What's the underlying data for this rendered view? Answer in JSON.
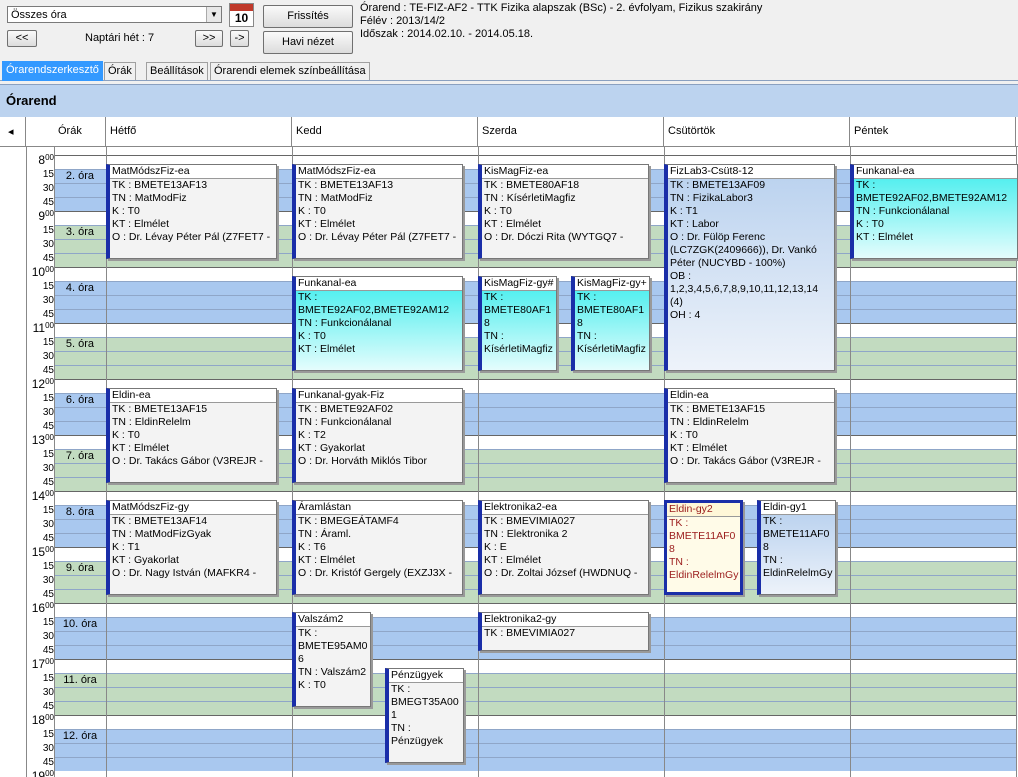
{
  "toolbar": {
    "combo_value": "Összes óra",
    "cal_icon_day": "10",
    "prev_label": "<<",
    "week_label": "Naptári hét : 7",
    "next_label": ">>",
    "next_small_label": "->",
    "refresh_label": "Frissítés",
    "month_view_label": "Havi nézet"
  },
  "info": {
    "line1": "Órarend : TE-FIZ-AF2 - TTK Fizika alapszak (BSc) - 2. évfolyam, Fizikus szakirány",
    "line2": "Félév : 2013/14/2",
    "line3": "Időszak : 2014.02.10. - 2014.05.18."
  },
  "tabs": [
    "Órarendszerkesztő",
    "Órák",
    "Beállítások",
    "Órarendi elemek színbeállítása"
  ],
  "panel_title": "Órarend",
  "grid": {
    "scroll_left": "◂",
    "headers": [
      "Órák",
      "Hétfő",
      "Kedd",
      "Szerda",
      "Csütörtök",
      "Péntek"
    ],
    "hours": [
      "8",
      "9",
      "10",
      "11",
      "12",
      "13",
      "14",
      "15",
      "16",
      "17",
      "18",
      "19"
    ],
    "minute_sup": "00",
    "minutes": [
      "15",
      "30",
      "45"
    ],
    "slots": [
      "2. óra",
      "3. óra",
      "4. óra",
      "5. óra",
      "6. óra",
      "7. óra",
      "8. óra",
      "9. óra",
      "10. óra",
      "11. óra",
      "12. óra"
    ]
  },
  "colors": {
    "blue_band": "#a9c8ef",
    "green_band": "#c2dbc0",
    "card_border": "#1a2ea8",
    "tab_active": "#3399ff"
  },
  "events": [
    {
      "title": "MatMódszFiz-ea",
      "lines": [
        "TK : BMETE13AF13",
        "TN : MatModFiz",
        "K : T0",
        "KT : Elmélet",
        "O : Dr. Lévay Péter Pál (Z7FET7 -"
      ]
    },
    {
      "title": "MatMódszFiz-ea",
      "lines": [
        "TK : BMETE13AF13",
        "TN : MatModFiz",
        "K : T0",
        "KT : Elmélet",
        "O : Dr. Lévay Péter Pál (Z7FET7 -"
      ]
    },
    {
      "title": "KisMagFiz-ea",
      "lines": [
        "TK : BMETE80AF18",
        "TN : KísérletiMagfiz",
        "K : T0",
        "KT : Elmélet",
        "O : Dr. Dóczi Rita (WYTGQ7 -"
      ]
    },
    {
      "title": "FizLab3-Csüt8-12",
      "lines": [
        "TK : BMETE13AF09",
        "TN : FizikaLabor3",
        "K : T1",
        "KT : Labor",
        "O : Dr. Fülöp Ferenc",
        "(LC7ZGK(2409666)), Dr. Vankó",
        "Péter (NUCYBD - 100%)",
        "OB :",
        "1,2,3,4,5,6,7,8,9,10,11,12,13,14",
        "(4)",
        "OH : 4"
      ]
    },
    {
      "title": "Funkanal-ea",
      "lines": [
        "TK :",
        "BMETE92AF02,BMETE92AM12",
        "TN : Funkcionálanal",
        "K : T0",
        "KT : Elmélet"
      ]
    },
    {
      "title": "Funkanal-ea",
      "lines": [
        "TK :",
        "BMETE92AF02,BMETE92AM12",
        "TN : Funkcionálanal",
        "K : T0",
        "KT : Elmélet"
      ]
    },
    {
      "title": "KisMagFiz-gy#",
      "lines": [
        "TK :",
        "BMETE80AF1",
        "8",
        "TN :",
        "KísérletiMagfiz"
      ]
    },
    {
      "title": "KisMagFiz-gy+",
      "lines": [
        "TK :",
        "BMETE80AF1",
        "8",
        "TN :",
        "KísérletiMagfiz"
      ]
    },
    {
      "title": "Eldin-ea",
      "lines": [
        "TK : BMETE13AF15",
        "TN : EldinRelelm",
        "K : T0",
        "KT : Elmélet",
        "O : Dr. Takács Gábor (V3REJR -"
      ]
    },
    {
      "title": "Funkanal-gyak-Fiz",
      "lines": [
        "TK : BMETE92AF02",
        "TN : Funkcionálanal",
        "K : T2",
        "KT : Gyakorlat",
        "O : Dr. Horváth Miklós Tibor"
      ]
    },
    {
      "title": "Eldin-ea",
      "lines": [
        "TK : BMETE13AF15",
        "TN : EldinRelelm",
        "K : T0",
        "KT : Elmélet",
        "O : Dr. Takács Gábor (V3REJR -"
      ]
    },
    {
      "title": "MatMódszFiz-gy",
      "lines": [
        "TK : BMETE13AF14",
        "TN : MatModFizGyak",
        "K : T1",
        "KT : Gyakorlat",
        "O : Dr. Nagy István (MAFKR4 -"
      ]
    },
    {
      "title": "Áramlástan",
      "lines": [
        "TK : BMEGEÁTAMF4",
        "TN : Áraml.",
        "K : T6",
        "KT : Elmélet",
        "O : Dr. Kristóf Gergely (EXZJ3X -"
      ]
    },
    {
      "title": "Elektronika2-ea",
      "lines": [
        "TK : BMEVIMIA027",
        "TN : Elektronika 2",
        "K : E",
        "KT : Elmélet",
        "O : Dr. Zoltai József (HWDNUQ -"
      ]
    },
    {
      "title": "Eldin-gy2",
      "lines": [
        "TK :",
        "BMETE11AF0",
        "8",
        "TN :",
        "EldinRelelmGy"
      ]
    },
    {
      "title": "Eldin-gy1",
      "lines": [
        "TK :",
        "BMETE11AF0",
        "8",
        "TN :",
        "EldinRelelmGy"
      ]
    },
    {
      "title": "Valszám2",
      "lines": [
        "TK :",
        "BMETE95AM0",
        "6",
        "TN : Valszám2",
        "K : T0"
      ]
    },
    {
      "title": "Elektronika2-gy",
      "lines": [
        "TK : BMEVIMIA027"
      ]
    },
    {
      "title": "Pénzügyek",
      "lines": [
        "TK :",
        "BMEGT35A00",
        "1",
        "TN :",
        "Pénzügyek"
      ]
    }
  ]
}
